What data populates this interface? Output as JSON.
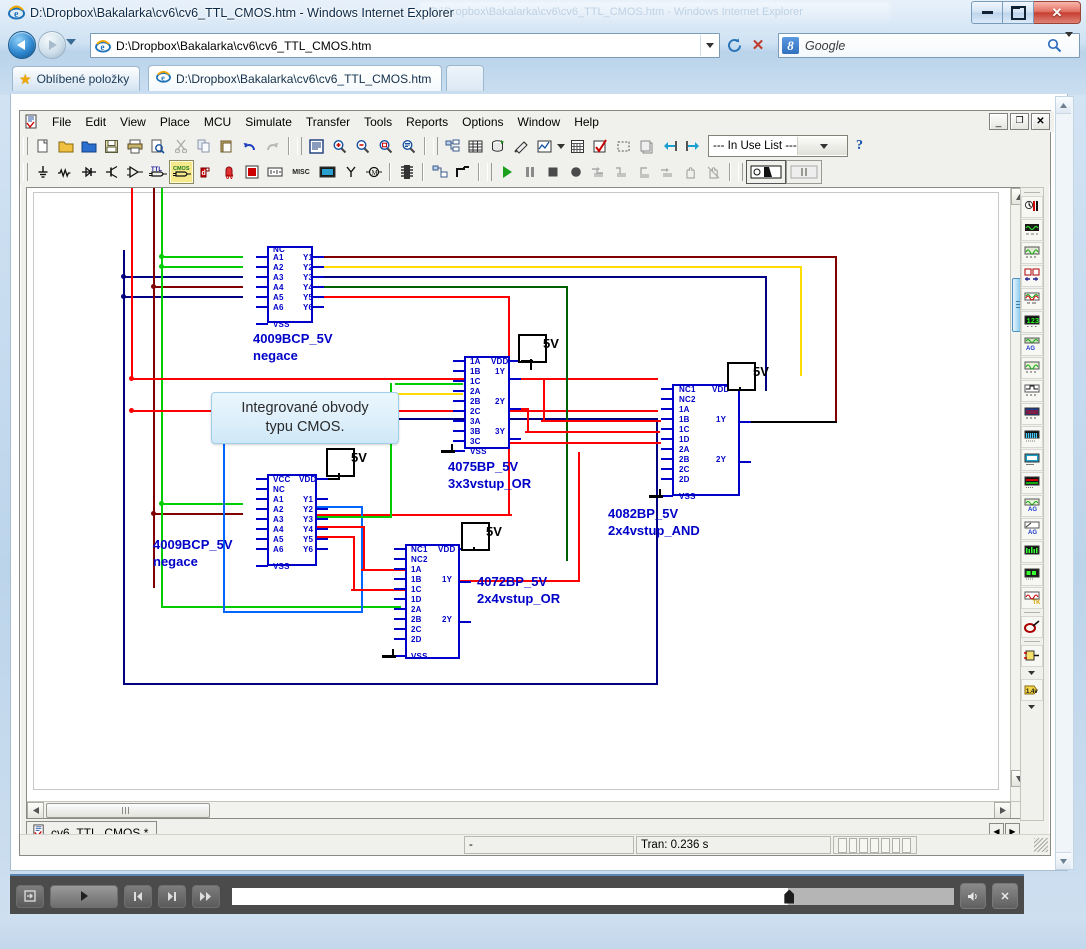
{
  "browser": {
    "window_title": "D:\\Dropbox\\Bakalarka\\cv6\\cv6_TTL_CMOS.htm - Windows Internet Explorer",
    "ghost_title": "D:\\Dropbox\\Bakalarka\\cv6\\cv6_TTL_CMOS.htm - Windows Internet Explorer",
    "address": "D:\\Dropbox\\Bakalarka\\cv6\\cv6_TTL_CMOS.htm",
    "search_placeholder": "Google",
    "search_engine_badge": "8",
    "favorites_label": "Oblíbené položky",
    "tab_label": "D:\\Dropbox\\Bakalarka\\cv6\\cv6_TTL_CMOS.htm",
    "minimize": "minimize",
    "maximize": "maximize",
    "close": "close"
  },
  "app": {
    "menu": [
      {
        "label": "File"
      },
      {
        "label": "Edit"
      },
      {
        "label": "View"
      },
      {
        "label": "Place"
      },
      {
        "label": "MCU"
      },
      {
        "label": "Simulate"
      },
      {
        "label": "Transfer"
      },
      {
        "label": "Tools"
      },
      {
        "label": "Reports"
      },
      {
        "label": "Options"
      },
      {
        "label": "Window"
      },
      {
        "label": "Help"
      }
    ],
    "mdi_buttons": {
      "minimize": "_",
      "restore": "❐",
      "close": "✕"
    },
    "in_use_list": "--- In Use List ---",
    "help_button": "?",
    "project_tab": "cv6_TTL_CMOS *",
    "status": {
      "left_cell": "-",
      "tran": "Tran: 0.236 s"
    }
  },
  "tooltip": {
    "text": "Integrované obvody\ntypu CMOS."
  },
  "schematic": {
    "components": [
      {
        "id": "u1",
        "ref": "4009BCP_5V",
        "note": "negace",
        "left_pins": [
          "NC",
          "A1",
          "A2",
          "A3",
          "A4",
          "A5",
          "A6",
          "",
          "VSS"
        ],
        "right_pins": [
          "",
          "Y1",
          "Y2",
          "Y3",
          "Y4",
          "Y5",
          "Y6",
          "",
          ""
        ]
      },
      {
        "id": "u2",
        "ref": "4075BP_5V",
        "note": "3x3vstup_OR",
        "left_pins": [
          "1A",
          "1B",
          "1C",
          "2A",
          "2B",
          "2C",
          "3A",
          "3B",
          "3C",
          "VSS"
        ],
        "right_pins": [
          "VDD",
          "1Y",
          "",
          "",
          "2Y",
          "",
          "",
          "3Y",
          "",
          ""
        ]
      },
      {
        "id": "u3",
        "ref": "4082BP_5V",
        "note": "2x4vstup_AND",
        "left_pins": [
          "NC1",
          "NC2",
          "1A",
          "1B",
          "1C",
          "1D",
          "2A",
          "2B",
          "2C",
          "2D",
          "",
          "VSS"
        ],
        "right_pins": [
          "VDD",
          "",
          "",
          "1Y",
          "",
          "",
          "",
          "2Y",
          "",
          "",
          "",
          ""
        ]
      },
      {
        "id": "u4",
        "ref": "4009BCP_5V",
        "note": "negace",
        "left_pins": [
          "VCC",
          "NC",
          "A1",
          "A2",
          "A3",
          "A4",
          "A5",
          "A6",
          "",
          "VSS"
        ],
        "right_pins": [
          "VDD",
          "",
          "Y1",
          "Y2",
          "Y3",
          "Y4",
          "Y5",
          "Y6",
          "",
          ""
        ]
      },
      {
        "id": "u5",
        "ref": "4072BP_5V",
        "note": "2x4vstup_OR",
        "left_pins": [
          "NC1",
          "NC2",
          "1A",
          "1B",
          "1C",
          "1D",
          "2A",
          "2B",
          "2C",
          "2D",
          "",
          "VSS"
        ],
        "right_pins": [
          "VDD",
          "",
          "",
          "1Y",
          "",
          "",
          "",
          "2Y",
          "",
          "",
          "",
          ""
        ]
      }
    ],
    "power_labels": [
      "5V",
      "5V",
      "5V",
      "5V",
      "5V"
    ],
    "colors": {
      "component": "#0000c8",
      "wire_red": "#ff0000",
      "wire_green": "#00cc00",
      "wire_blue": "#0000b0",
      "wire_navy": "#000080",
      "wire_darkred": "#800000",
      "wire_yellow": "#ffdd00",
      "wire_darkgreen": "#006000",
      "wire_brightblue": "#0066ff",
      "wire_black": "#000000"
    }
  },
  "instruments": {
    "count": 19,
    "names": [
      "multimeter-icon",
      "function-generator-icon",
      "wattmeter-icon",
      "oscilloscope-icon",
      "four-channel-oscilloscope-icon",
      "bode-plotter-icon",
      "frequency-counter-icon",
      "word-generator-icon",
      "logic-converter-icon",
      "logic-analyzer-icon",
      "ir-analyzer-icon",
      "distortion-analyzer-icon",
      "spectrum-analyzer-icon",
      "network-analyzer-icon",
      "agilent-function-generator-icon",
      "agilent-multimeter-icon",
      "agilent-oscilloscope-icon",
      "tektronix-oscilloscope-icon",
      "measurement-probe-icon"
    ]
  },
  "player": {
    "buttons": [
      "eject-button",
      "play-button",
      "prev-button",
      "next-button",
      "fastforward-button"
    ],
    "volume": "volume-button",
    "close": "close-button",
    "progress_percent": 77
  }
}
